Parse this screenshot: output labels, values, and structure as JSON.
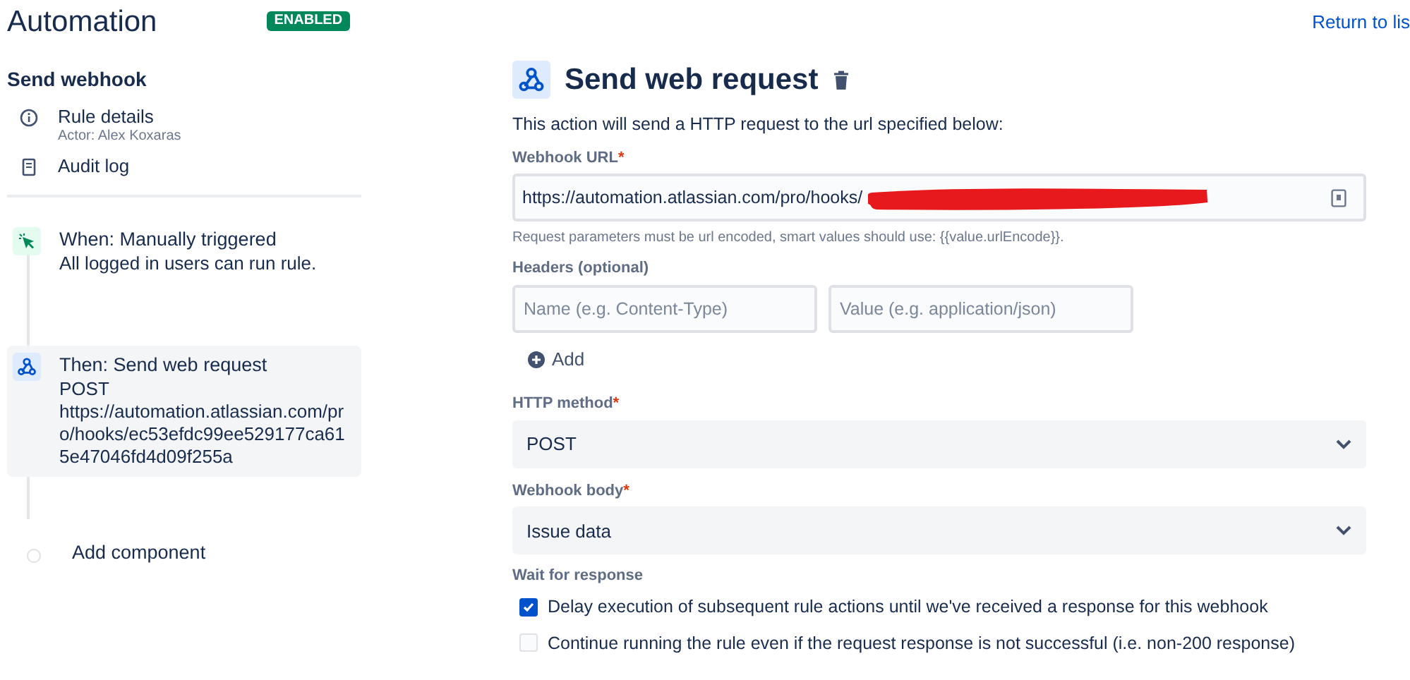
{
  "header": {
    "title": "Automation",
    "status_badge": "ENABLED",
    "return_link": "Return to lis"
  },
  "sidebar": {
    "rule_name": "Send webhook",
    "items": [
      {
        "kind": "info",
        "label": "Rule details",
        "sub": "Actor: Alex Koxaras"
      },
      {
        "kind": "log",
        "label": "Audit log"
      }
    ],
    "steps": [
      {
        "kind": "trigger",
        "title": "When: Manually triggered",
        "lines": [
          "All logged in users can run rule."
        ],
        "selected": false
      },
      {
        "kind": "action",
        "title": "Then: Send web request",
        "lines": [
          "POST",
          "https://automation.atlassian.com/pro/hooks/ec53efdc99ee529177ca615e47046fd4d09f255a"
        ],
        "selected": true
      }
    ],
    "add_component": "Add component"
  },
  "panel": {
    "title": "Send web request",
    "description": "This action will send a HTTP request to the url specified below:",
    "url": {
      "label": "Webhook URL",
      "required_mark": "*",
      "value": "https://automation.atlassian.com/pro/hooks/",
      "redacted": true,
      "help": "Request parameters must be url encoded, smart values should use: {{value.urlEncode}}."
    },
    "headers": {
      "label": "Headers (optional)",
      "name_placeholder": "Name (e.g. Content-Type)",
      "value_placeholder": "Value (e.g. application/json)",
      "add": "Add"
    },
    "selects": [
      {
        "label": "HTTP method",
        "required_mark": "*",
        "value": "POST"
      },
      {
        "label": "Webhook body",
        "required_mark": "*",
        "value": "Issue data"
      }
    ],
    "wait": {
      "label": "Wait for response",
      "options": [
        {
          "label": "Delay execution of subsequent rule actions until we've received a response for this webhook",
          "checked": true
        },
        {
          "label": "Continue running the rule even if the request response is not successful (i.e. non-200 response)",
          "checked": false
        }
      ]
    }
  }
}
